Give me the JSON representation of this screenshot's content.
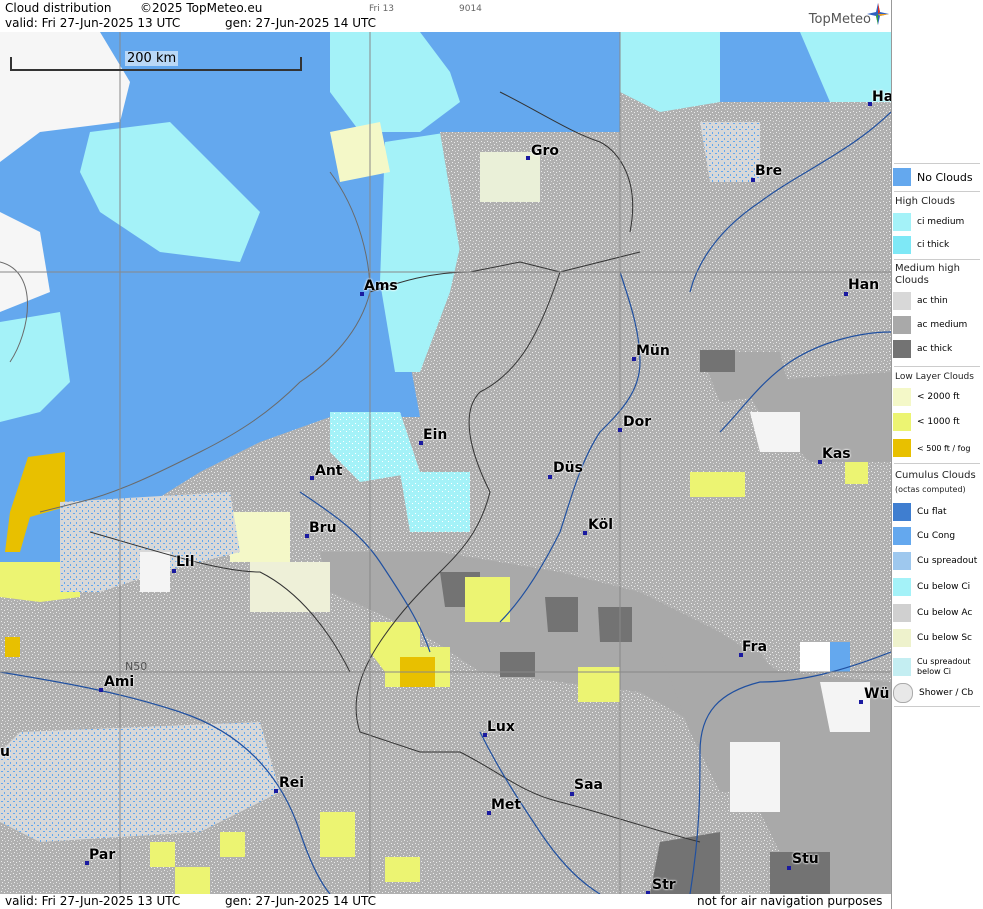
{
  "header": {
    "title": "Cloud distribution",
    "copyright": "©2025 TopMeteo.eu",
    "valid": "valid:  Fri  27-Jun-2025  13 UTC",
    "gen": "gen: 27-Jun-2025 14 UTC",
    "code1": "Fri 13",
    "code2": "9014",
    "logo": "TopMeteo"
  },
  "footer": {
    "valid": "valid:  Fri  27-Jun-2025  13 UTC",
    "gen": "gen: 27-Jun-2025 14 UTC",
    "disclaimer": "not for air navigation purposes"
  },
  "map": {
    "scale_label": "200 km",
    "lat_label": "N50",
    "cities": [
      "Gro",
      "Bre",
      "Ha",
      "Ams",
      "Han",
      "Mün",
      "Dor",
      "Ein",
      "Kas",
      "Ant",
      "Düs",
      "Bru",
      "Köl",
      "Lil",
      "Fra",
      "Ami",
      "Wü",
      "Lux",
      "u",
      "Rei",
      "Saa",
      "Met",
      "Par",
      "Stu",
      "Str"
    ]
  },
  "legend": {
    "colors": {
      "no_clouds": "#64a8ee",
      "ci_medium": "#a4f2f8",
      "ci_thick": "#7ee8f6",
      "ac_thin": "#d8d8d8",
      "ac_medium": "#a9a9a9",
      "ac_thick": "#737373",
      "low_2000": "#f4f8c8",
      "low_1000": "#ecf472",
      "low_500": "#e8c000"
    },
    "no_clouds": "No Clouds",
    "high_head": "High Clouds",
    "ci_medium": "ci medium",
    "ci_thick": "ci thick",
    "medium_head": "Medium high Clouds",
    "ac_thin": "ac thin",
    "ac_medium": "ac medium",
    "ac_thick": "ac thick",
    "low_head": "Low Layer Clouds",
    "low_2000": "< 2000 ft",
    "low_1000": "< 1000 ft",
    "low_500": "< 500 ft / fog",
    "cu_head": "Cumulus Clouds",
    "cu_sub": "(octas computed)",
    "cu_flat": "Cu flat",
    "cu_cong": "Cu Cong",
    "cu_spreadout": "Cu spreadout",
    "cu_below_ci": "Cu below Ci",
    "cu_below_ac": "Cu below Ac",
    "cu_below_sc": "Cu below Sc",
    "cu_spreadout_below_ci": "Cu spreadout below Ci",
    "shower_cb": "Shower / Cb"
  }
}
